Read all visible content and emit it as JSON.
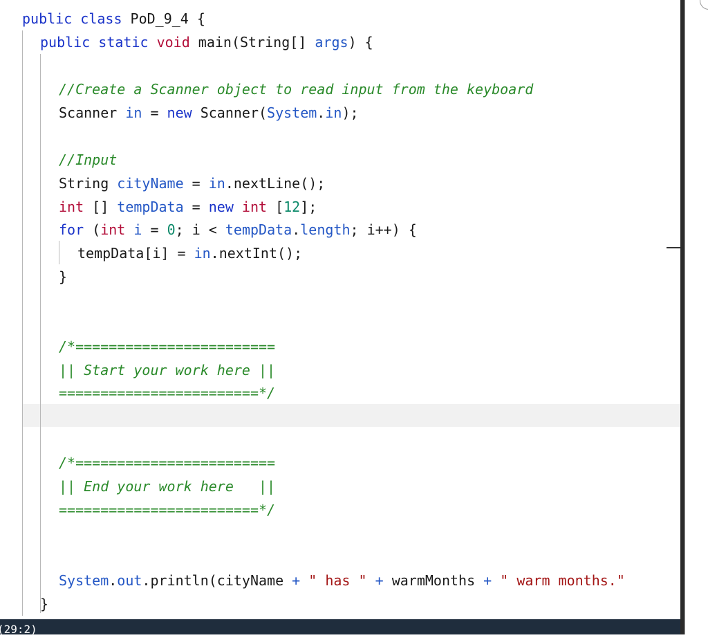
{
  "editor": {
    "lines": [
      {
        "tokens": [
          {
            "t": "public",
            "c": "kw"
          },
          {
            "t": " ",
            "c": "pl"
          },
          {
            "t": "class",
            "c": "kw"
          },
          {
            "t": " PoD_9_4 {",
            "c": "pl"
          }
        ]
      },
      {
        "tokens": [
          {
            "t": "public",
            "c": "kw"
          },
          {
            "t": " ",
            "c": "pl"
          },
          {
            "t": "static",
            "c": "kw"
          },
          {
            "t": " ",
            "c": "pl"
          },
          {
            "t": "void",
            "c": "ty"
          },
          {
            "t": " main(String[] ",
            "c": "pl"
          },
          {
            "t": "args",
            "c": "vr"
          },
          {
            "t": ") {",
            "c": "pl"
          }
        ]
      },
      {
        "tokens": []
      },
      {
        "tokens": [
          {
            "t": "//Create a Scanner object to read input from the keyboard",
            "c": "cm"
          }
        ]
      },
      {
        "tokens": [
          {
            "t": "Scanner ",
            "c": "pl"
          },
          {
            "t": "in",
            "c": "vr"
          },
          {
            "t": " = ",
            "c": "pl"
          },
          {
            "t": "new",
            "c": "kw"
          },
          {
            "t": " Scanner(",
            "c": "pl"
          },
          {
            "t": "System",
            "c": "vr"
          },
          {
            "t": ".",
            "c": "pl"
          },
          {
            "t": "in",
            "c": "vr"
          },
          {
            "t": ");",
            "c": "pl"
          }
        ]
      },
      {
        "tokens": []
      },
      {
        "tokens": [
          {
            "t": "//Input",
            "c": "cm"
          }
        ]
      },
      {
        "tokens": [
          {
            "t": "String ",
            "c": "pl"
          },
          {
            "t": "cityName",
            "c": "vr"
          },
          {
            "t": " = ",
            "c": "pl"
          },
          {
            "t": "in",
            "c": "vr"
          },
          {
            "t": ".nextLine();",
            "c": "pl"
          }
        ]
      },
      {
        "tokens": [
          {
            "t": "int",
            "c": "ty"
          },
          {
            "t": " [] ",
            "c": "pl"
          },
          {
            "t": "tempData",
            "c": "vr"
          },
          {
            "t": " = ",
            "c": "pl"
          },
          {
            "t": "new",
            "c": "kw"
          },
          {
            "t": " ",
            "c": "pl"
          },
          {
            "t": "int",
            "c": "ty"
          },
          {
            "t": " [",
            "c": "pl"
          },
          {
            "t": "12",
            "c": "nm"
          },
          {
            "t": "];",
            "c": "pl"
          }
        ]
      },
      {
        "tokens": [
          {
            "t": "for",
            "c": "kw"
          },
          {
            "t": " (",
            "c": "pl"
          },
          {
            "t": "int",
            "c": "ty"
          },
          {
            "t": " ",
            "c": "pl"
          },
          {
            "t": "i",
            "c": "vr"
          },
          {
            "t": " = ",
            "c": "pl"
          },
          {
            "t": "0",
            "c": "nm"
          },
          {
            "t": "; i < ",
            "c": "pl"
          },
          {
            "t": "tempData",
            "c": "vr"
          },
          {
            "t": ".",
            "c": "pl"
          },
          {
            "t": "length",
            "c": "vr"
          },
          {
            "t": "; i++) {",
            "c": "pl"
          }
        ]
      },
      {
        "tokens": [
          {
            "t": "tempData[i] = ",
            "c": "pl"
          },
          {
            "t": "in",
            "c": "vr"
          },
          {
            "t": ".nextInt();",
            "c": "pl"
          }
        ]
      },
      {
        "tokens": [
          {
            "t": "}",
            "c": "pl"
          }
        ]
      },
      {
        "tokens": []
      },
      {
        "tokens": []
      },
      {
        "tokens": [
          {
            "t": "/*========================",
            "c": "cm"
          }
        ]
      },
      {
        "tokens": [
          {
            "t": "|| Start your work here ||",
            "c": "cm"
          }
        ]
      },
      {
        "tokens": [
          {
            "t": "========================*/",
            "c": "cm"
          }
        ]
      },
      {
        "tokens": []
      },
      {
        "tokens": []
      },
      {
        "tokens": [
          {
            "t": "/*========================",
            "c": "cm"
          }
        ]
      },
      {
        "tokens": [
          {
            "t": "|| End your work here   ||",
            "c": "cm"
          }
        ]
      },
      {
        "tokens": [
          {
            "t": "========================*/",
            "c": "cm"
          }
        ]
      },
      {
        "tokens": []
      },
      {
        "tokens": []
      },
      {
        "tokens": [
          {
            "t": "System",
            "c": "vr"
          },
          {
            "t": ".",
            "c": "pl"
          },
          {
            "t": "out",
            "c": "vr"
          },
          {
            "t": ".println(cityName ",
            "c": "pl"
          },
          {
            "t": "+",
            "c": "vr"
          },
          {
            "t": " ",
            "c": "pl"
          },
          {
            "t": "\" has \"",
            "c": "st"
          },
          {
            "t": " ",
            "c": "pl"
          },
          {
            "t": "+",
            "c": "vr"
          },
          {
            "t": " warmMonths ",
            "c": "pl"
          },
          {
            "t": "+",
            "c": "vr"
          },
          {
            "t": " ",
            "c": "pl"
          },
          {
            "t": "\" warm months.\"",
            "c": "st"
          }
        ]
      },
      {
        "tokens": [
          {
            "t": "}",
            "c": "pl"
          }
        ]
      }
    ]
  },
  "status_bar": {
    "cursor_position": "(29:2)"
  },
  "colors": {
    "keyword": "#1a33c9",
    "type": "#b30f3a",
    "variable": "#2457c5",
    "number": "#0d8a6a",
    "string": "#a31515",
    "comment": "#2a8a2a",
    "status_bar_bg": "#1f2d3d"
  }
}
